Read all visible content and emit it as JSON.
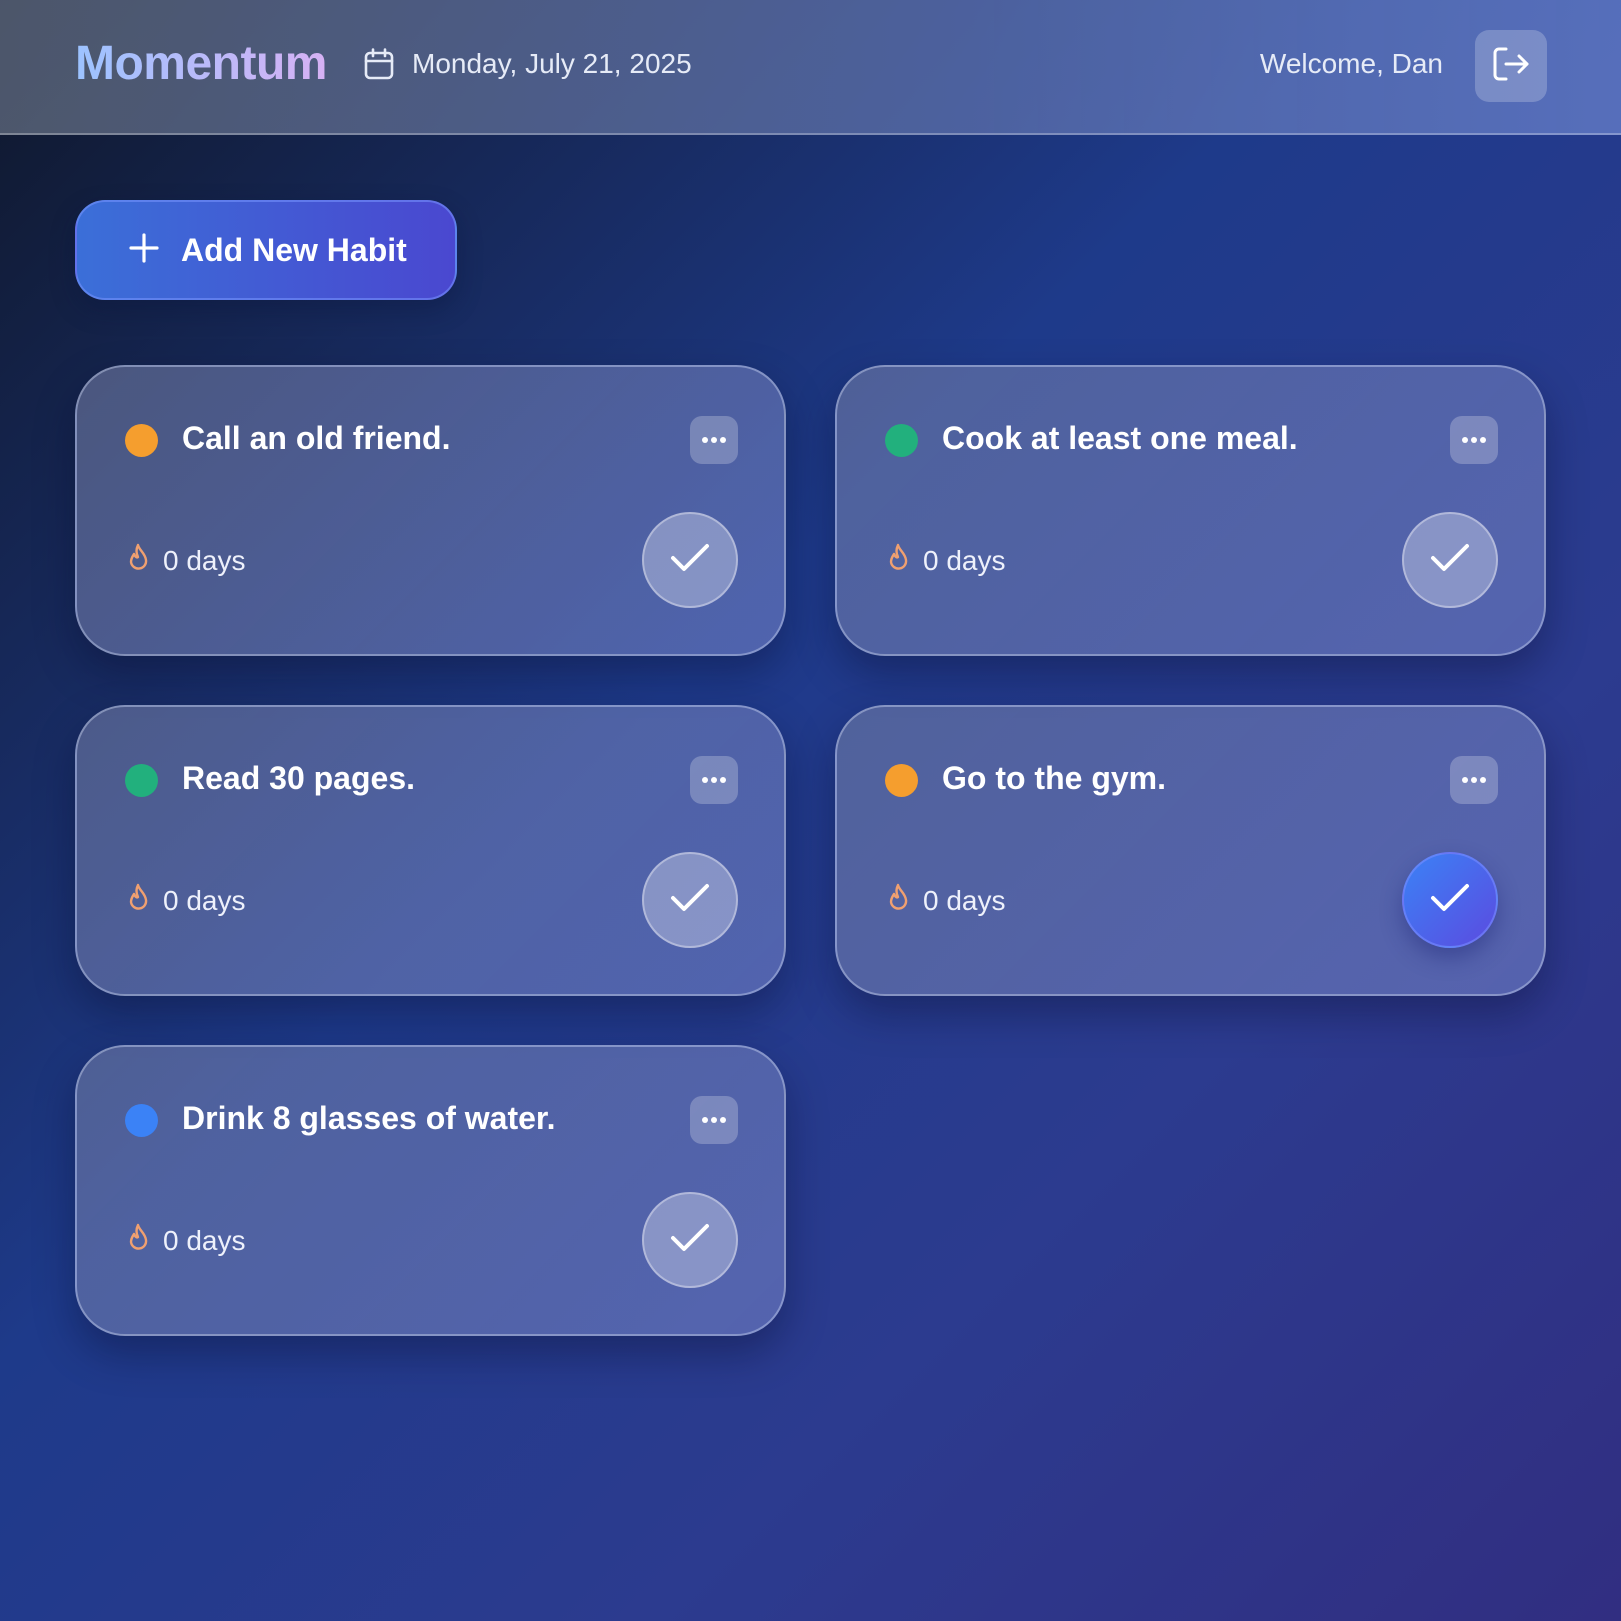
{
  "header": {
    "app_title": "Momentum",
    "date": "Monday, July 21, 2025",
    "welcome": "Welcome, Dan",
    "icons": {
      "calendar": "calendar-icon",
      "logout": "logout-icon"
    }
  },
  "actions": {
    "add_habit_label": "Add New Habit",
    "add_icon": "plus-icon"
  },
  "habits": [
    {
      "title": "Call an old friend.",
      "color": "#f59e2e",
      "streak": "0 days",
      "completed": false
    },
    {
      "title": "Cook at least one meal.",
      "color": "#22b07d",
      "streak": "0 days",
      "completed": false
    },
    {
      "title": "Read 30 pages.",
      "color": "#22b07d",
      "streak": "0 days",
      "completed": false
    },
    {
      "title": "Go to the gym.",
      "color": "#f59e2e",
      "streak": "0 days",
      "completed": true
    },
    {
      "title": "Drink 8 glasses of water.",
      "color": "#3b82f6",
      "streak": "0 days",
      "completed": false
    }
  ],
  "colors": {
    "accent": "#4a55d8",
    "streak_icon": "#f0a070"
  }
}
